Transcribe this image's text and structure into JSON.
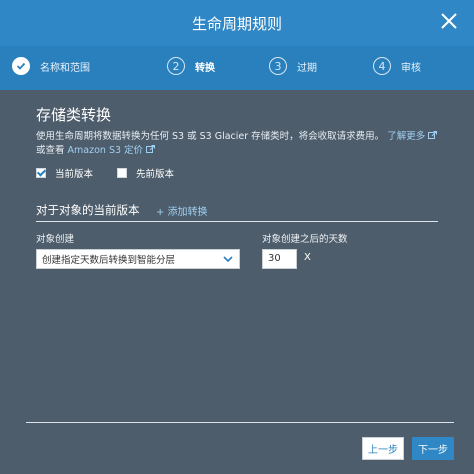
{
  "dialog": {
    "title": "生命周期规则",
    "close_icon": "close-icon"
  },
  "steps": [
    {
      "number": "✓",
      "label": "名称和范围",
      "state": "done"
    },
    {
      "number": "2",
      "label": "转换",
      "state": "active"
    },
    {
      "number": "3",
      "label": "过期",
      "state": "pending"
    },
    {
      "number": "4",
      "label": "审核",
      "state": "pending"
    }
  ],
  "section": {
    "heading": "存储类转换",
    "desc_line1": "使用生命周期将数据转换为任何 S3 或 S3 Glacier 存储类时，将会收取请求费用。",
    "learn_more": "了解更多",
    "desc_line2_prefix": "或查看",
    "pricing_link": "Amazon S3 定价",
    "current_version_label": "当前版本",
    "current_version_checked": true,
    "previous_version_label": "先前版本",
    "previous_version_checked": false
  },
  "transitions": {
    "heading": "对于对象的当前版本",
    "add_link": "+ 添加转换",
    "object_creation_label": "对象创建",
    "days_label": "对象创建之后的天数",
    "select_value": "创建指定天数后转换到智能分层",
    "days_value": "30",
    "days_suffix": "X"
  },
  "footer": {
    "prev_label": "上一步",
    "next_label": "下一步"
  },
  "colors": {
    "titlebar": "#2f87c5",
    "stepbar": "#2a80bd",
    "background": "#4e5d6b",
    "link": "#9fd0f2"
  }
}
